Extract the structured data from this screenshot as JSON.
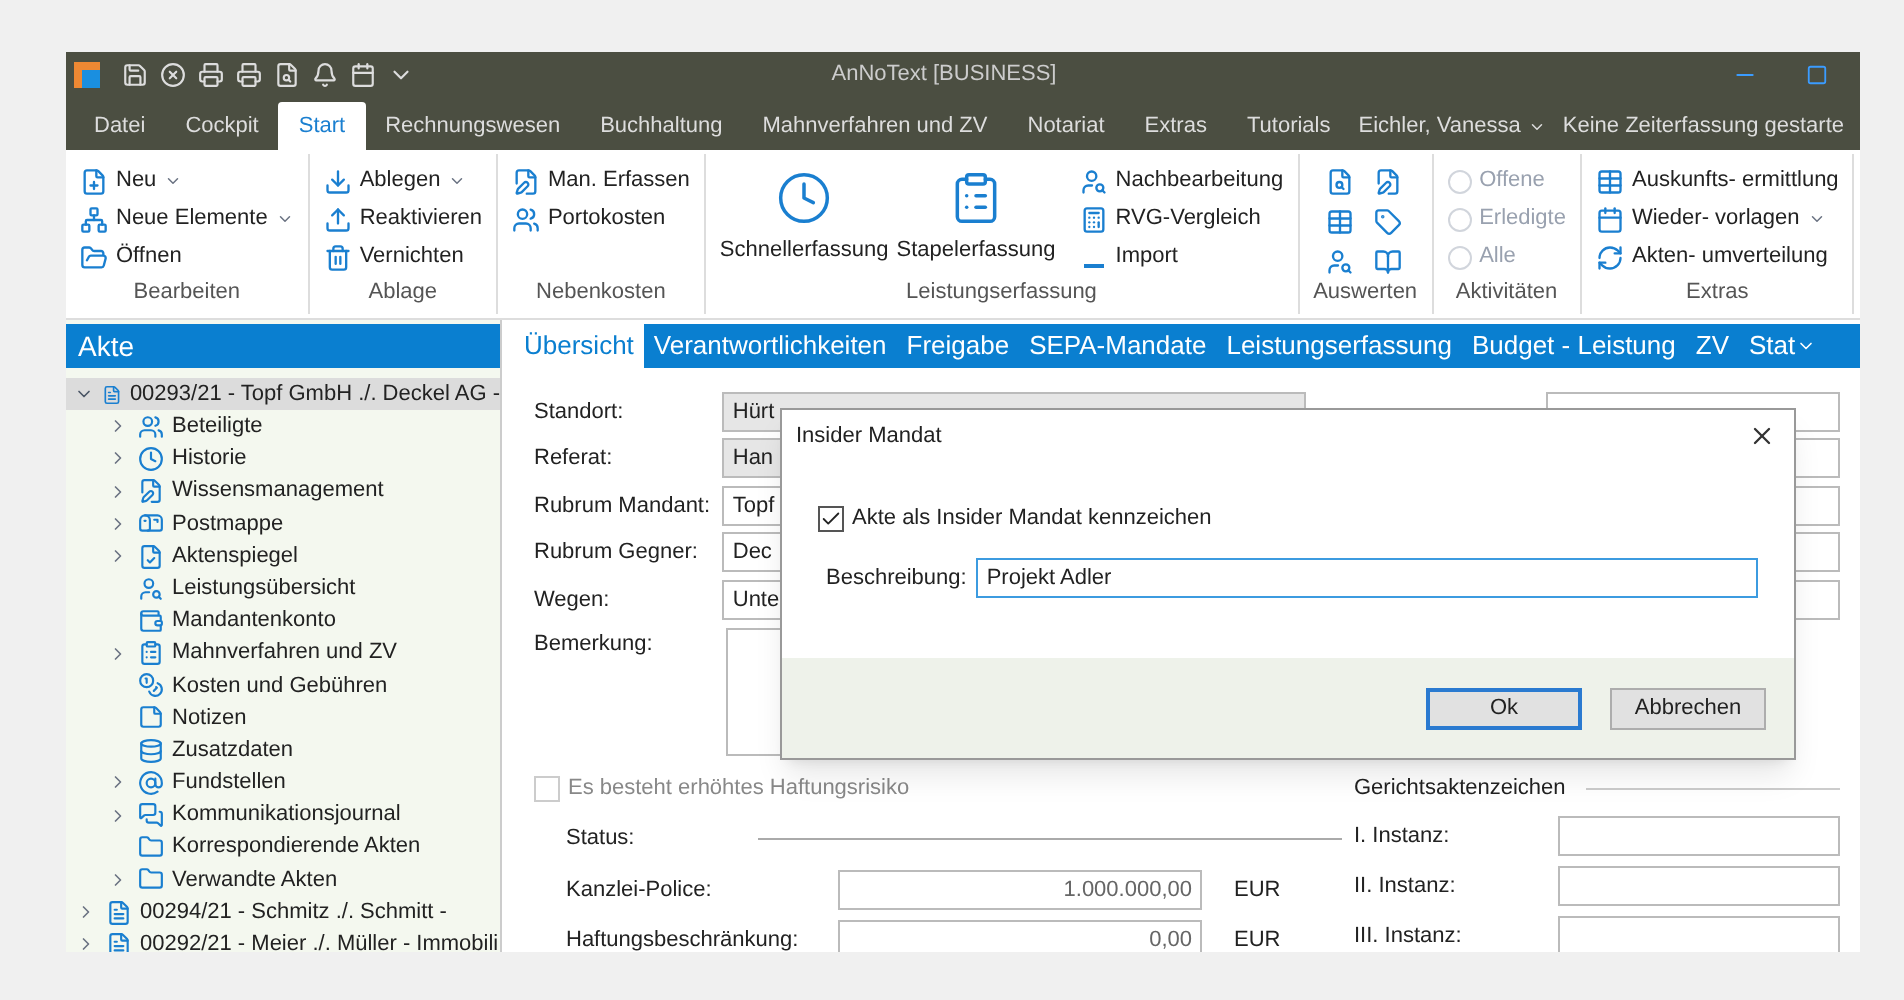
{
  "window": {
    "title": "AnNoText [BUSINESS]"
  },
  "ribbon_tabs": [
    {
      "label": "Datei",
      "selected": false
    },
    {
      "label": "Cockpit",
      "selected": false
    },
    {
      "label": "Start",
      "selected": true
    },
    {
      "label": "Rechnungswesen",
      "selected": false
    },
    {
      "label": "Buchhaltung",
      "selected": false
    },
    {
      "label": "Mahnverfahren und ZV",
      "selected": false
    },
    {
      "label": "Notariat",
      "selected": false
    },
    {
      "label": "Extras",
      "selected": false
    },
    {
      "label": "Tutorials",
      "selected": false
    }
  ],
  "user": {
    "name": "Eichler, Vanessa",
    "time_tracking": "Keine Zeiterfassung gestarte"
  },
  "ribbon_groups": [
    {
      "label": "Bearbeiten",
      "kind": "list",
      "items": [
        {
          "label": "Neu",
          "dropdown": true
        },
        {
          "label": "Neue Elemente",
          "dropdown": true
        },
        {
          "label": "Öffnen",
          "dropdown": false
        }
      ]
    },
    {
      "label": "Ablage",
      "kind": "list",
      "items": [
        {
          "label": "Ablegen",
          "dropdown": true
        },
        {
          "label": "Reaktivieren",
          "dropdown": false
        },
        {
          "label": "Vernichten",
          "dropdown": false
        }
      ]
    },
    {
      "label": "Nebenkosten",
      "kind": "list",
      "items": [
        {
          "label": "Man. Erfassen",
          "dropdown": false
        },
        {
          "label": "Portokosten",
          "dropdown": false
        }
      ]
    },
    {
      "label": "Leistungserfassung",
      "kind": "large",
      "items": [
        {
          "label": "Schnellerfassung"
        },
        {
          "label": "Stapelerfassung"
        }
      ],
      "side_items": [
        {
          "label": "Nachbearbeitung",
          "dropdown": false
        },
        {
          "label": "RVG-Vergleich",
          "dropdown": false
        },
        {
          "label": "Import",
          "dropdown": false
        }
      ]
    },
    {
      "label": "Auswerten",
      "kind": "icons"
    },
    {
      "label": "Aktivitäten",
      "kind": "radios",
      "items": [
        {
          "label": "Offene",
          "selected": false,
          "disabled": true
        },
        {
          "label": "Erledigte",
          "selected": false,
          "disabled": true
        },
        {
          "label": "Alle",
          "selected": false,
          "disabled": true
        }
      ]
    },
    {
      "label": "Extras",
      "kind": "list",
      "items": [
        {
          "label": "Auskunfts- ermittlung",
          "dropdown": false
        },
        {
          "label": "Wieder- vorlagen",
          "dropdown": true
        },
        {
          "label": "Akten- umverteilung",
          "dropdown": false
        }
      ]
    }
  ],
  "sidebar": {
    "title": "Akte",
    "tree": [
      {
        "label": "00293/21 - Topf GmbH ./. Deckel AG -",
        "expanded": true,
        "selected": true,
        "children": [
          {
            "label": "Beteiligte",
            "expanded": false,
            "selected": false
          },
          {
            "label": "Historie",
            "expanded": false,
            "selected": false
          },
          {
            "label": "Wissensmanagement",
            "expanded": false,
            "selected": false
          },
          {
            "label": "Postmappe",
            "expanded": false,
            "selected": false
          },
          {
            "label": "Aktenspiegel",
            "expanded": false,
            "selected": false
          },
          {
            "label": "Leistungsübersicht",
            "selected": false
          },
          {
            "label": "Mandantenkonto",
            "selected": false
          },
          {
            "label": "Mahnverfahren und ZV",
            "expanded": false,
            "selected": false
          },
          {
            "label": "Kosten und Gebühren",
            "selected": false
          },
          {
            "label": "Notizen",
            "selected": false
          },
          {
            "label": "Zusatzdaten",
            "selected": false
          },
          {
            "label": "Fundstellen",
            "expanded": false,
            "selected": false
          },
          {
            "label": "Kommunikationsjournal",
            "expanded": false,
            "selected": false
          },
          {
            "label": "Korrespondierende Akten",
            "selected": false
          },
          {
            "label": "Verwandte Akten",
            "expanded": false,
            "selected": false
          }
        ]
      },
      {
        "label": "00294/21 - Schmitz ./. Schmitt -",
        "expanded": false,
        "selected": false
      },
      {
        "label": "00292/21 - Meier ./. Müller - Immobili",
        "expanded": false,
        "selected": false
      }
    ]
  },
  "content_tabs": [
    {
      "label": "Übersicht",
      "selected": true
    },
    {
      "label": "Verantwortlichkeiten",
      "selected": false
    },
    {
      "label": "Freigabe",
      "selected": false
    },
    {
      "label": "SEPA-Mandate",
      "selected": false
    },
    {
      "label": "Leistungserfassung",
      "selected": false
    },
    {
      "label": "Budget - Leistung",
      "selected": false
    },
    {
      "label": "ZV",
      "selected": false
    },
    {
      "label": "Stat",
      "selected": false
    }
  ],
  "form": {
    "fields": [
      {
        "label": "Standort:",
        "value": "Hürt",
        "kind": "dropdown"
      },
      {
        "label": "Referat:",
        "value": "Han",
        "kind": "dropdown"
      },
      {
        "label": "Rubrum Mandant:",
        "value": "Topf",
        "kind": "text"
      },
      {
        "label": "Rubrum Gegner:",
        "value": "Dec",
        "kind": "text"
      },
      {
        "label": "Wegen:",
        "value": "Unte",
        "kind": "text"
      }
    ],
    "remark_label": "Bemerkung:",
    "risk": {
      "label": "Es besteht erhöhtes Haftungsrisiko",
      "checked": false,
      "disabled": true
    },
    "status_label": "Status:",
    "amounts": [
      {
        "label": "Kanzlei-Police:",
        "value": "1.000.000,00",
        "currency": "EUR"
      },
      {
        "label": "Haftungsbeschränkung:",
        "value": "0,00",
        "currency": "EUR"
      }
    ],
    "court_title": "Gerichtsaktenzeichen",
    "court_fields": [
      {
        "label": "I. Instanz:"
      },
      {
        "label": "II. Instanz:"
      },
      {
        "label": "III. Instanz:"
      }
    ]
  },
  "dialog": {
    "title": "Insider Mandat",
    "checkbox": {
      "label": "Akte als Insider Mandat kennzeichen",
      "checked": true
    },
    "description": {
      "label": "Beschreibung:",
      "value": "Projekt Adler"
    },
    "buttons": [
      {
        "label": "Ok",
        "default": true
      },
      {
        "label": "Abbrechen",
        "default": false
      }
    ]
  }
}
